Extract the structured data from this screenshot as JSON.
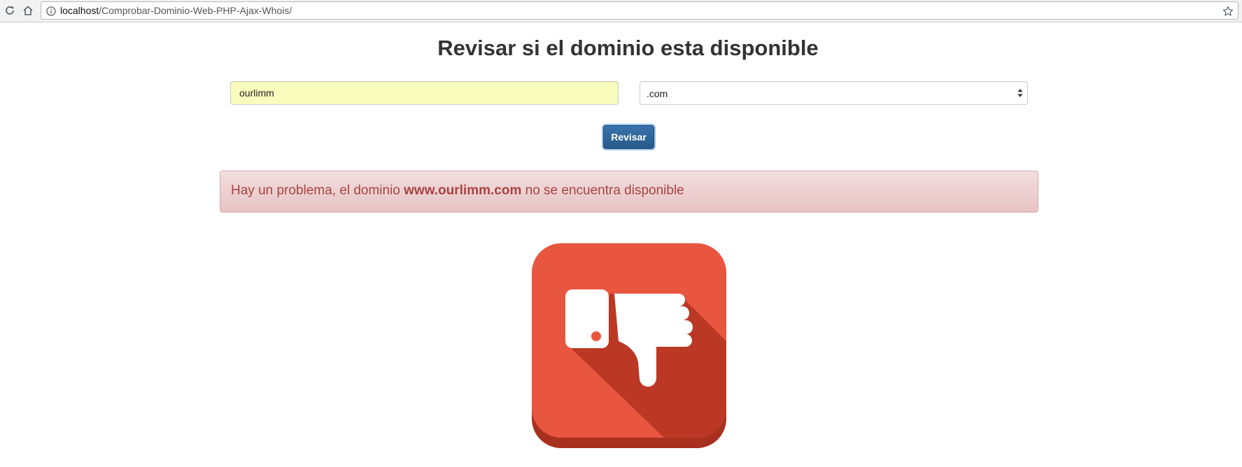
{
  "browser": {
    "url_host": "localhost",
    "url_path": "/Comprobar-Dominio-Web-PHP-Ajax-Whois/",
    "icons": [
      "reload-icon",
      "home-icon",
      "info-icon",
      "star-icon"
    ]
  },
  "page": {
    "title": "Revisar si el dominio esta disponible"
  },
  "form": {
    "domain_value": "ourlimm",
    "tld_selected": ".com",
    "submit_label": "Revisar"
  },
  "alert": {
    "prefix": "Hay un problema, el dominio ",
    "domain": "www.ourlimm.com",
    "suffix": " no se encuentra disponible"
  },
  "result_icon": {
    "name": "thumbs-down-icon",
    "colors": {
      "background": "#e85640",
      "shadow": "#bb3824",
      "base": "#a8301f",
      "symbol": "#ffffff"
    }
  },
  "colors": {
    "button": "#2e6da4",
    "alert_text": "#a94442",
    "alert_bg": "#f2dede",
    "input_autofill": "#fafcbd"
  }
}
